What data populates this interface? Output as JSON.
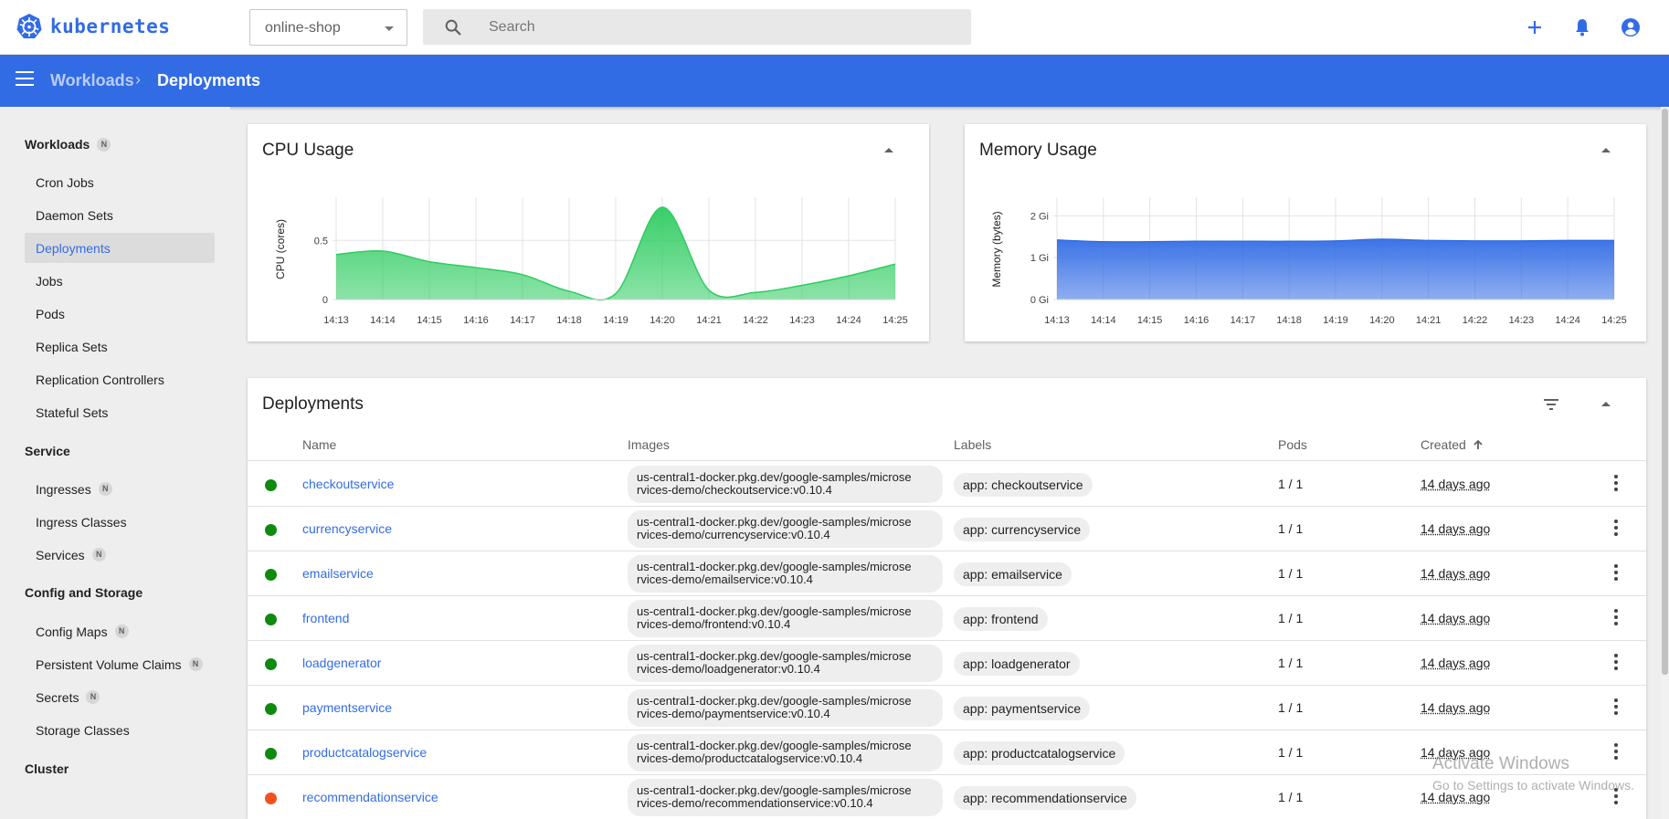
{
  "app": {
    "name": "kubernetes"
  },
  "namespace": {
    "selected": "online-shop"
  },
  "search": {
    "placeholder": "Search"
  },
  "top_actions": [
    "plus-icon",
    "bell-icon",
    "account-circle-icon"
  ],
  "breadcrumb": {
    "parent": "Workloads",
    "current": "Deployments"
  },
  "sidebar": {
    "sections": [
      {
        "label": "Workloads",
        "badge": "N",
        "items": [
          {
            "label": "Cron Jobs"
          },
          {
            "label": "Daemon Sets"
          },
          {
            "label": "Deployments",
            "active": true
          },
          {
            "label": "Jobs"
          },
          {
            "label": "Pods"
          },
          {
            "label": "Replica Sets"
          },
          {
            "label": "Replication Controllers"
          },
          {
            "label": "Stateful Sets"
          }
        ]
      },
      {
        "label": "Service",
        "items": [
          {
            "label": "Ingresses",
            "badge": "N"
          },
          {
            "label": "Ingress Classes"
          },
          {
            "label": "Services",
            "badge": "N"
          }
        ]
      },
      {
        "label": "Config and Storage",
        "items": [
          {
            "label": "Config Maps",
            "badge": "N"
          },
          {
            "label": "Persistent Volume Claims",
            "badge": "N"
          },
          {
            "label": "Secrets",
            "badge": "N"
          },
          {
            "label": "Storage Classes"
          }
        ]
      },
      {
        "label": "Cluster",
        "items": []
      }
    ]
  },
  "colors": {
    "brand": "#326ce5",
    "cpu_fill": "#2ecc60",
    "memory_fill": "#326ce5",
    "status_ok": "#0f8a0f",
    "status_error": "#f4511e"
  },
  "chart_data": [
    {
      "type": "area",
      "title": "CPU Usage",
      "ylabel": "CPU (cores)",
      "xlabel": "",
      "x": [
        "14:13",
        "14:14",
        "14:15",
        "14:16",
        "14:17",
        "14:18",
        "14:19",
        "14:20",
        "14:21",
        "14:22",
        "14:23",
        "14:24",
        "14:25"
      ],
      "y": [
        0.38,
        0.41,
        0.32,
        0.27,
        0.21,
        0.07,
        0.05,
        0.78,
        0.08,
        0.06,
        0.12,
        0.2,
        0.3
      ],
      "yticks": [
        "0",
        "0.5"
      ],
      "ylim": [
        0,
        0.85
      ],
      "grid": true
    },
    {
      "type": "area",
      "title": "Memory Usage",
      "ylabel": "Memory (bytes)",
      "xlabel": "",
      "x": [
        "14:13",
        "14:14",
        "14:15",
        "14:16",
        "14:17",
        "14:18",
        "14:19",
        "14:20",
        "14:21",
        "14:22",
        "14:23",
        "14:24",
        "14:25"
      ],
      "y": [
        1.42,
        1.38,
        1.38,
        1.39,
        1.39,
        1.39,
        1.4,
        1.44,
        1.41,
        1.4,
        1.4,
        1.41,
        1.41
      ],
      "yticks": [
        "0 Gi",
        "1 Gi",
        "2 Gi"
      ],
      "ylim": [
        0,
        2.4
      ],
      "grid": true
    }
  ],
  "deployments": {
    "title": "Deployments",
    "columns": {
      "name": "Name",
      "images": "Images",
      "labels": "Labels",
      "pods": "Pods",
      "created": "Created"
    },
    "rows": [
      {
        "status": "ok",
        "name": "checkoutservice",
        "image": "us-central1-docker.pkg.dev/google-samples/microse\nrvices-demo/checkoutservice:v0.10.4",
        "label": "app: checkoutservice",
        "pods": "1 / 1",
        "created": "14 days ago"
      },
      {
        "status": "ok",
        "name": "currencyservice",
        "image": "us-central1-docker.pkg.dev/google-samples/microse\nrvices-demo/currencyservice:v0.10.4",
        "label": "app: currencyservice",
        "pods": "1 / 1",
        "created": "14 days ago"
      },
      {
        "status": "ok",
        "name": "emailservice",
        "image": "us-central1-docker.pkg.dev/google-samples/microse\nrvices-demo/emailservice:v0.10.4",
        "label": "app: emailservice",
        "pods": "1 / 1",
        "created": "14 days ago"
      },
      {
        "status": "ok",
        "name": "frontend",
        "image": "us-central1-docker.pkg.dev/google-samples/microse\nrvices-demo/frontend:v0.10.4",
        "label": "app: frontend",
        "pods": "1 / 1",
        "created": "14 days ago"
      },
      {
        "status": "ok",
        "name": "loadgenerator",
        "image": "us-central1-docker.pkg.dev/google-samples/microse\nrvices-demo/loadgenerator:v0.10.4",
        "label": "app: loadgenerator",
        "pods": "1 / 1",
        "created": "14 days ago"
      },
      {
        "status": "ok",
        "name": "paymentservice",
        "image": "us-central1-docker.pkg.dev/google-samples/microse\nrvices-demo/paymentservice:v0.10.4",
        "label": "app: paymentservice",
        "pods": "1 / 1",
        "created": "14 days ago"
      },
      {
        "status": "ok",
        "name": "productcatalogservice",
        "image": "us-central1-docker.pkg.dev/google-samples/microse\nrvices-demo/productcatalogservice:v0.10.4",
        "label": "app: productcatalogservice",
        "pods": "1 / 1",
        "created": "14 days ago"
      },
      {
        "status": "error",
        "name": "recommendationservice",
        "image": "us-central1-docker.pkg.dev/google-samples/microse\nrvices-demo/recommendationservice:v0.10.4",
        "label": "app: recommendationservice",
        "pods": "1 / 1",
        "created": "14 days ago"
      }
    ]
  },
  "watermark": {
    "line1": "Activate Windows",
    "line2": "Go to Settings to activate Windows."
  }
}
